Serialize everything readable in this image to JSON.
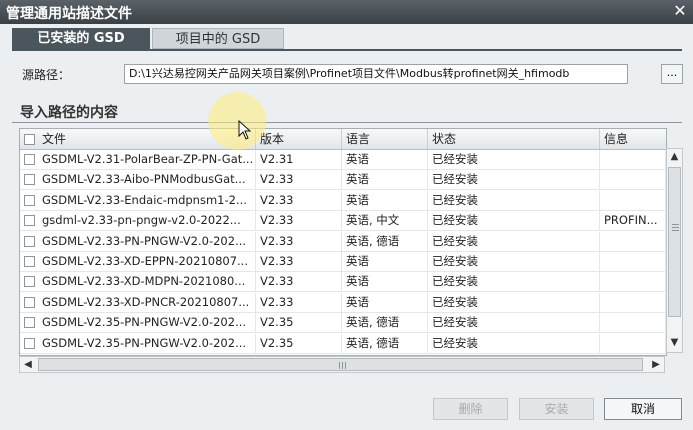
{
  "window": {
    "title": "管理通用站描述文件",
    "close_label": "✕"
  },
  "tabs": [
    {
      "label": "已安装的 GSD",
      "active": true
    },
    {
      "label": "项目中的 GSD",
      "active": false
    }
  ],
  "source": {
    "label": "源路径：",
    "value": "D:\\1兴达易控网关产品网关项目案例\\Profinet项目文件\\Modbus转profinet网关_hfimodb",
    "browse_label": "..."
  },
  "section_title": "导入路径的内容",
  "table": {
    "columns": [
      "文件",
      "版本",
      "语言",
      "状态",
      "信息"
    ],
    "rows": [
      {
        "file": "GSDML-V2.31-PolarBear-ZP-PN-Gat...",
        "version": "V2.31",
        "language": "英语",
        "status": "已经安装",
        "info": ""
      },
      {
        "file": "GSDML-V2.33-Aibo-PNModbusGat...",
        "version": "V2.33",
        "language": "英语",
        "status": "已经安装",
        "info": ""
      },
      {
        "file": "GSDML-V2.33-Endaic-mdpnsm1-2...",
        "version": "V2.33",
        "language": "英语",
        "status": "已经安装",
        "info": ""
      },
      {
        "file": "gsdml-v2.33-pn-pngw-v2.0-2022...",
        "version": "V2.33",
        "language": "英语, 中文",
        "status": "已经安装",
        "info": "PROFIN..."
      },
      {
        "file": "GSDML-V2.33-PN-PNGW-V2.0-202...",
        "version": "V2.33",
        "language": "英语, 德语",
        "status": "已经安装",
        "info": ""
      },
      {
        "file": "GSDML-V2.33-XD-EPPN-20210807...",
        "version": "V2.33",
        "language": "英语",
        "status": "已经安装",
        "info": ""
      },
      {
        "file": "GSDML-V2.33-XD-MDPN-2021080...",
        "version": "V2.33",
        "language": "英语",
        "status": "已经安装",
        "info": ""
      },
      {
        "file": "GSDML-V2.33-XD-PNCR-20210807...",
        "version": "V2.33",
        "language": "英语",
        "status": "已经安装",
        "info": ""
      },
      {
        "file": "GSDML-V2.35-PN-PNGW-V2.0-202...",
        "version": "V2.35",
        "language": "英语, 德语",
        "status": "已经安装",
        "info": ""
      },
      {
        "file": "GSDML-V2.35-PN-PNGW-V2.0-202...",
        "version": "V2.35",
        "language": "英语, 德语",
        "status": "已经安装",
        "info": ""
      }
    ]
  },
  "scrollbar": {
    "up": "▲",
    "down": "▼",
    "left": "◀",
    "right": "▶"
  },
  "buttons": {
    "delete_label": "删除",
    "install_label": "安装",
    "cancel_label": "取消"
  },
  "colors": {
    "tab_active": "#4a555c",
    "titlebar": "#394046"
  }
}
